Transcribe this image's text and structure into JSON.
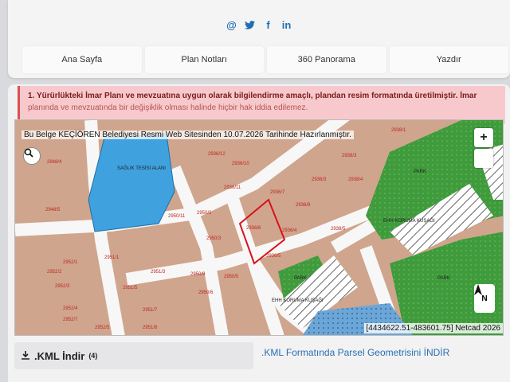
{
  "social": {
    "at": "@",
    "twitter": "t",
    "facebook": "f",
    "linkedin": "in"
  },
  "nav": [
    {
      "label": "Ana Sayfa"
    },
    {
      "label": "Plan Notları"
    },
    {
      "label": "360 Panorama"
    },
    {
      "label": "Yazdır"
    }
  ],
  "notice": {
    "line1": "1. Yürürlükteki İmar Planı ve mevzuatına uygun olarak bilgilendirme amaçlı, plandan resim formatında üretilmiştir. İmar",
    "line2": "planında ve mevzuatında bir değişiklik olması halinde hiçbir hak iddia edilemez."
  },
  "map": {
    "watermark": "Bu Belge KEÇİÖREN Belediyesi Resmi Web Sitesinden 10.07.2026 Tarihinde Hazırlanmıştır.",
    "coords": "[4434622.51-483601.75] Netcad 2026",
    "zoom_in": "+",
    "compass_letter": "N",
    "parcels": [
      "2948/4",
      "2948/5",
      "2952/1",
      "2952/2",
      "2952/3",
      "2952/4",
      "2952/5",
      "2952/7",
      "2951/1",
      "2951/3",
      "2951/5",
      "2951/7",
      "2951/8",
      "2950/2",
      "2950/3",
      "2950/5",
      "2950/6",
      "2950/9",
      "2950/11",
      "2936/3",
      "2936/4",
      "2936/5",
      "2936/6",
      "2936/7",
      "2936/9",
      "2936/10",
      "2936/11",
      "2936/12",
      "2938/1",
      "2938/3",
      "2938/4",
      "2938/5"
    ],
    "labels": {
      "park": "PARK",
      "saglik": "SAĞLIK TESİSİ ALANI",
      "koruma": "EHH KORUMA KUŞAĞI"
    }
  },
  "kml": {
    "button_label": ".KML İndir",
    "button_sup": "(4)",
    "link": ".KML Formatında Parsel Geometrisini İNDİR"
  }
}
